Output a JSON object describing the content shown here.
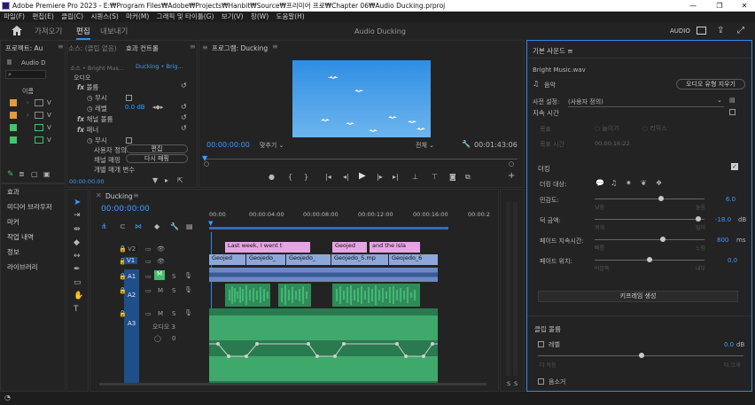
{
  "titlebar": {
    "title": "Adobe Premiere Pro 2023 - E:₩Program Files₩Adobe₩Projects₩Hanbit₩Source₩프리미어 프로₩Chapter 06₩Audio Ducking.prproj",
    "minimize": "—",
    "maximize": "❐",
    "close": "✕"
  },
  "menu": [
    "파일(F)",
    "편집(E)",
    "클립(C)",
    "시퀀스(S)",
    "마커(M)",
    "그래픽 및 타이틀(G)",
    "보기(V)",
    "창(W)",
    "도움말(H)"
  ],
  "header": {
    "home_icon": "home-icon",
    "tabs": [
      "가져오기",
      "편집",
      "내보내기"
    ],
    "active_tab": "편집",
    "center_title": "Audio Ducking",
    "workspace_label": "AUDIO"
  },
  "project": {
    "tab": "프로젝트: Au",
    "bin": "Audio D",
    "column": "이름",
    "items": [
      "V",
      "V",
      "V",
      "V"
    ],
    "footer_tabs": [
      "효과",
      "미디어 브라우저",
      "마커",
      "작업 내역",
      "정보",
      "라이브러리"
    ]
  },
  "effect_controls": {
    "tabs": [
      "소스: (클립 없음)",
      "효과 컨트롤"
    ],
    "source": "소스 • Bright Mus...",
    "sequence": "Ducking • Brig...",
    "section": "오디오",
    "rows": [
      {
        "label": "볼륨",
        "indent": 1
      },
      {
        "label": "무시",
        "indent": 2
      },
      {
        "label": "레벨",
        "value": "0.0 dB",
        "indent": 2
      },
      {
        "label": "채널 볼륨",
        "indent": 1
      },
      {
        "label": "패너",
        "indent": 1
      },
      {
        "label": "무시",
        "indent": 2
      },
      {
        "label": "사용자 정의",
        "button": "편집",
        "indent": 2
      },
      {
        "label": "채널 매핑",
        "button": "다시 매핑",
        "indent": 2
      },
      {
        "label": "개별 매개 변수",
        "indent": 1
      }
    ],
    "timecode": "00:00:00:00"
  },
  "program": {
    "tab": "프로그램: Ducking",
    "timecode": "00:00:00:00",
    "fit": "맞추기",
    "quality": "전체",
    "duration": "00:01:43:06"
  },
  "timeline": {
    "tab": "Ducking",
    "timecode": "00:00:00:00",
    "ruler": [
      "00:00",
      "00:00:04:00",
      "00:00:08:00",
      "00:00:12:00",
      "00:00:16:00",
      "00:00:2"
    ],
    "video_tracks": [
      {
        "name": "V2",
        "clips": [
          "Last week, I went t",
          "Geojed",
          "and the isla"
        ]
      },
      {
        "name": "V1",
        "clips": [
          "Geojed",
          "Geojedo_",
          "Geojedo_",
          "Geojedo_5.mp",
          "Geojedo_6"
        ]
      }
    ],
    "audio_tracks": [
      {
        "name": "A1",
        "flags": [
          "M",
          "S"
        ]
      },
      {
        "name": "A2",
        "flags": [
          "M",
          "S"
        ]
      },
      {
        "name": "A3",
        "flags": [
          "M",
          "S"
        ],
        "label": "오디오 3",
        "value": "0"
      }
    ],
    "meter_labels": [
      "S",
      "S"
    ]
  },
  "essential_sound": {
    "tab": "기본 사운드",
    "clip": "Bright Music.wav",
    "type": "음악",
    "clear_type": "오디오 유형 지우기",
    "preset_label": "사전 설정:",
    "preset_value": "(사용자 정의)",
    "duration_title": "지속 시간",
    "target": "목표",
    "opt1": "늘이기",
    "opt2": "리믹스",
    "target_duration_label": "목표 시간",
    "target_duration_value": "00:00:16:22",
    "ducking_title": "더킹",
    "duck_against_label": "더킹 대상:",
    "sensitivity_label": "민감도:",
    "sensitivity_value": "6.0",
    "sensitivity_min": "낮음",
    "sensitivity_max": "높음",
    "duck_amount_label": "덕 금액:",
    "duck_amount_value": "-18.0",
    "duck_amount_unit": "dB",
    "duck_amount_min": "적게",
    "duck_amount_max": "많이",
    "fade_duration_label": "페이드 지속시간:",
    "fade_duration_value": "800",
    "fade_duration_unit": "ms",
    "fade_min": "빠름",
    "fade_max": "느림",
    "fade_position_label": "페이드 위치:",
    "fade_position_value": "0.0",
    "fade_pos_min": "바깥쪽",
    "fade_pos_max": "내부",
    "generate_button": "키프레임 생성",
    "clip_volume_title": "클립 볼륨",
    "level_label": "레벨",
    "level_value": "0.0",
    "level_unit": "dB",
    "level_min": "더 작음",
    "level_max": "더 크게",
    "mute_label": "음소거"
  },
  "colors": {
    "accent": "#2d8ceb",
    "clip_pink": "#e9a3e8",
    "clip_blue": "#8fa7d8",
    "audio_green": "#3e9a64",
    "audio_green_light": "#52c27f"
  }
}
